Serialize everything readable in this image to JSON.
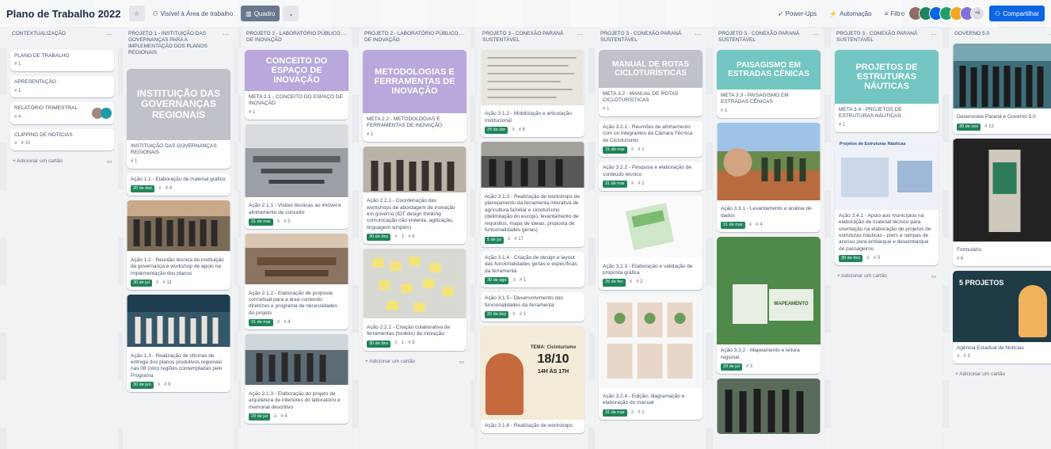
{
  "header": {
    "board_title": "Plano de Trabalho 2022",
    "visibility": "Visível à Área de trabalho",
    "view": "Quadro",
    "powerups": "Power-Ups",
    "automation": "Automação",
    "filter": "Filtro",
    "member_count": "+6",
    "share": "Compartilhar"
  },
  "colors": {
    "purple_cover": "#b8a8dc",
    "teal_cover": "#73c6c2",
    "gray_cover": "#bfc3c9",
    "due_green": "#1f845a",
    "share_blue": "#0c66e4"
  },
  "lists": [
    {
      "title": "CONTEXTUALIZAÇÃO",
      "cards": [
        {
          "title": "PLANO DE TRABALHO",
          "meta": "# 1"
        },
        {
          "title": "APRESENTAÇÃO",
          "meta": "# 1"
        },
        {
          "title": "RELATÓRIO TRIMESTRAL",
          "meta": "# 4"
        },
        {
          "title": "CLIPPING DE NOTÍCIAS",
          "meta": "# 10"
        }
      ],
      "add": "+ Adicionar um cartão"
    },
    {
      "title": "PROJETO 1 - INSTITUIÇÃO DAS GOVERNANÇAS PARA A IMPLEMENTAÇÃO DOS PLANOS REGIONAIS",
      "cover": "INSTITUIÇÃO DAS GOVERNANÇAS REGIONAIS",
      "cards": [
        {
          "title": "INSTITUIÇÃO DAS GOVERNANÇAS REGIONAIS",
          "meta": "# 1"
        },
        {
          "title": "Ação 1.1 - Elaboração de material gráfico",
          "due": "20 de dez",
          "meta": "# 4"
        },
        {
          "title": "Ação 1.2 - Reunião técnica de instituição da governança e workshop de apoio na implementação dos planos",
          "due": "30 de jul",
          "meta": "# 11"
        },
        {
          "title": "Ação 1.3 - Realização de oficinas de entrega dos planos produtivos regionais nas 08 (oito) regiões contempladas pelo Programa",
          "due": "30 de jun",
          "meta": "# 9"
        }
      ]
    },
    {
      "title": "PROJETO 2 - LABORATÓRIO PÚBLICO DE INOVAÇÃO",
      "cover": "CONCEITO DO ESPAÇO DE INOVAÇÃO",
      "cards": [
        {
          "title": "META 2.1 - CONCEITO DO ESPAÇO DE INOVAÇÃO",
          "meta": "# 1"
        },
        {
          "title": "Ação 2.1.1 - Visitas técnicas ao imóvel e alinhamento de conceito",
          "due": "31 de mar",
          "meta": "# 5"
        },
        {
          "title": "Ação 2.1.2 - Elaboração de proposta conceitual para a área contendo diretrizes e programa de necessidades do projeto",
          "due": "31 de mar",
          "meta": "# 4"
        },
        {
          "title": "Ação 2.1.3 - Elaboração do projeto de arquitetura de interiores do laboratório e memorial descritivo",
          "due": "29 de jul",
          "meta": "# 4"
        }
      ]
    },
    {
      "title": "PROJETO 2 - LABORATÓRIO PÚBLICO DE INOVAÇÃO",
      "cover": "METODOLOGIAS E FERRAMENTAS DE INOVAÇÃO",
      "cards": [
        {
          "title": "META 2.2 - METODOLOGIAS E FERRAMENTAS DE INOVAÇÃO",
          "meta": "# 1"
        },
        {
          "title": "Ação 2.2.1 - Coordenação das workshops de abordagem de inovação em governo (IDT design thinking comunicação não violenta, agilização, linguagem simples)",
          "due": "30 de dez",
          "meta": "1 · # 6"
        },
        {
          "title": "Ação 2.2.2 - Criação colaborativa de ferramentas (toolkits) de inovação",
          "due": "30 de dez",
          "meta": "1 · # 5"
        }
      ],
      "add": "+ Adicionar um cartão"
    },
    {
      "title": "PROJETO 3 - CONEXÃO PARANÁ SUSTENTÁVEL",
      "cards": [
        {
          "title": "Ação 3.1.2 - Mobilização e articulação institucional",
          "due": "25 de abr",
          "meta": "# 6"
        },
        {
          "title": "Ação 3.1.3 - Realização de workshops de planejamento da ferramenta interativa de agricultura familiar e cicloturismo (delimitação do escopo, levantamento de requisitos, mapa de ideias, proposta de funcionalidades gerais)",
          "due": "5 de jul",
          "meta": "# 17"
        },
        {
          "title": "Ação 3.1.4 - Criação de design e layout das funcionalidades gerais e específicas da ferramenta",
          "due": "30 de ago",
          "meta": "# 1"
        },
        {
          "title": "Ação 3.1.5 - Desenvolvimento das funcionalidades da ferramenta",
          "due": "20 de dez",
          "meta": "# 1"
        },
        {
          "title": "Ação 3.1.6 - Realização de workshops",
          "meta": ""
        }
      ],
      "poster": {
        "line1": "TEMA: Cicloturismo",
        "date": "18/10",
        "time": "14H ÀS 17H"
      }
    },
    {
      "title": "PROJETO 3 - CONEXÃO PARANÁ SUSTENTÁVEL",
      "cover": "MANUAL DE ROTAS CICLOTURÍSTICAS",
      "cards": [
        {
          "title": "META 3.2 - MANUAL DE ROTAS CICLOTURÍSTICAS",
          "meta": "# 1"
        },
        {
          "title": "Ação 3.2.1 - Reuniões de alinhamento com os integrantes da Câmara Técnica de Cicloturismo",
          "due": "31 de mar",
          "meta": "# 1"
        },
        {
          "title": "Ação 3.2.2 - Pesquisa e elaboração de conteúdo técnico",
          "due": "31 de mar",
          "meta": "# 2"
        },
        {
          "title": "Ação 3.2.3 - Elaboração e validação de proposta gráfica",
          "due": "25 de fev",
          "meta": "# 2"
        },
        {
          "title": "Ação 3.2.4 - Edição, diagramação e elaboração do manual",
          "due": "31 de mar",
          "meta": "# 1"
        }
      ]
    },
    {
      "title": "PROJETO 3 - CONEXÃO PARANÁ SUSTENTÁVEL",
      "cover": "PAISAGISMO EM ESTRADAS CÊNICAS",
      "cards": [
        {
          "title": "META 3.3 - PAISAGISMO EM ESTRADAS CÊNICAS",
          "meta": "# 1"
        },
        {
          "title": "Ação 3.3.1 - Levantamento e análise de dados",
          "due": "31 de mar",
          "meta": "# 4"
        },
        {
          "title": "Ação 3.3.2 - Mapeamento e leitura regional",
          "due": "29 de jul",
          "meta": "# 3"
        }
      ],
      "map_label": "MAPEAMENTO"
    },
    {
      "title": "PROJETO 3 - CONEXÃO PARANÁ SUSTENTÁVEL",
      "cover": "PROJETOS DE ESTRUTURAS NÁUTICAS",
      "cards": [
        {
          "title": "META 3.4 - PROJETOS DE ESTRUTURAS NÁUTICAS",
          "meta": "# 1"
        },
        {
          "title": "Ação 3.4.1 - Apoio aos municípios na elaboração de material técnico para orientação na elaboração de projetos de estruturas náuticas - píers e rampas de acesso para embarque e desembarque de passageiros",
          "due": "30 de dez",
          "meta": "# 3"
        }
      ],
      "doc_heading": "Projetos de Estruturas Náuticas",
      "add": "+ Adicionar um cartão"
    },
    {
      "title": "GOVERNO 5.0",
      "cards": [
        {
          "title": "Desenvolve Paraná e Governo 5.0",
          "due": "30 de nov",
          "meta": "# 13"
        },
        {
          "title": "Formulário",
          "meta": "# 6"
        },
        {
          "title": "Agência Estadual de Notícias",
          "meta": "# 3"
        }
      ],
      "banner": "5 PROJETOS",
      "add": "+ Adicionar um cartão"
    }
  ]
}
